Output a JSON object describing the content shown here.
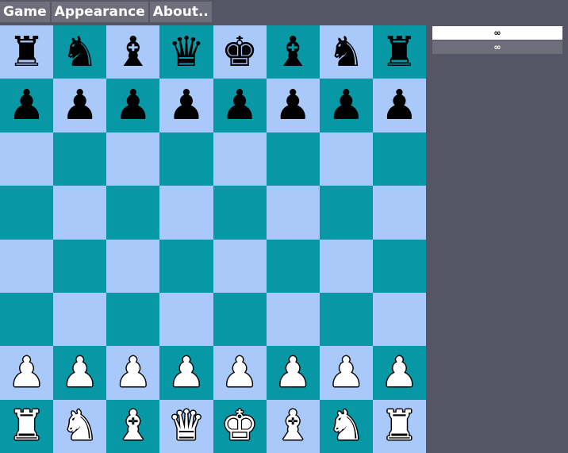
{
  "menu": {
    "game_label": "Game",
    "appearance_label": "Appearance",
    "about_label": "About.."
  },
  "colors": {
    "light_square": "#a9c9fb",
    "dark_square": "#0797a5",
    "background": "#565565",
    "menu_button": "#6f6e7b"
  },
  "clocks": {
    "black": "∞",
    "white": "∞"
  },
  "board": {
    "ranks": [
      [
        "r",
        "n",
        "b",
        "q",
        "k",
        "b",
        "n",
        "r"
      ],
      [
        "p",
        "p",
        "p",
        "p",
        "p",
        "p",
        "p",
        "p"
      ],
      [
        "",
        "",
        "",
        "",
        "",
        "",
        "",
        ""
      ],
      [
        "",
        "",
        "",
        "",
        "",
        "",
        "",
        ""
      ],
      [
        "",
        "",
        "",
        "",
        "",
        "",
        "",
        ""
      ],
      [
        "",
        "",
        "",
        "",
        "",
        "",
        "",
        ""
      ],
      [
        "P",
        "P",
        "P",
        "P",
        "P",
        "P",
        "P",
        "P"
      ],
      [
        "R",
        "N",
        "B",
        "Q",
        "K",
        "B",
        "N",
        "R"
      ]
    ]
  }
}
